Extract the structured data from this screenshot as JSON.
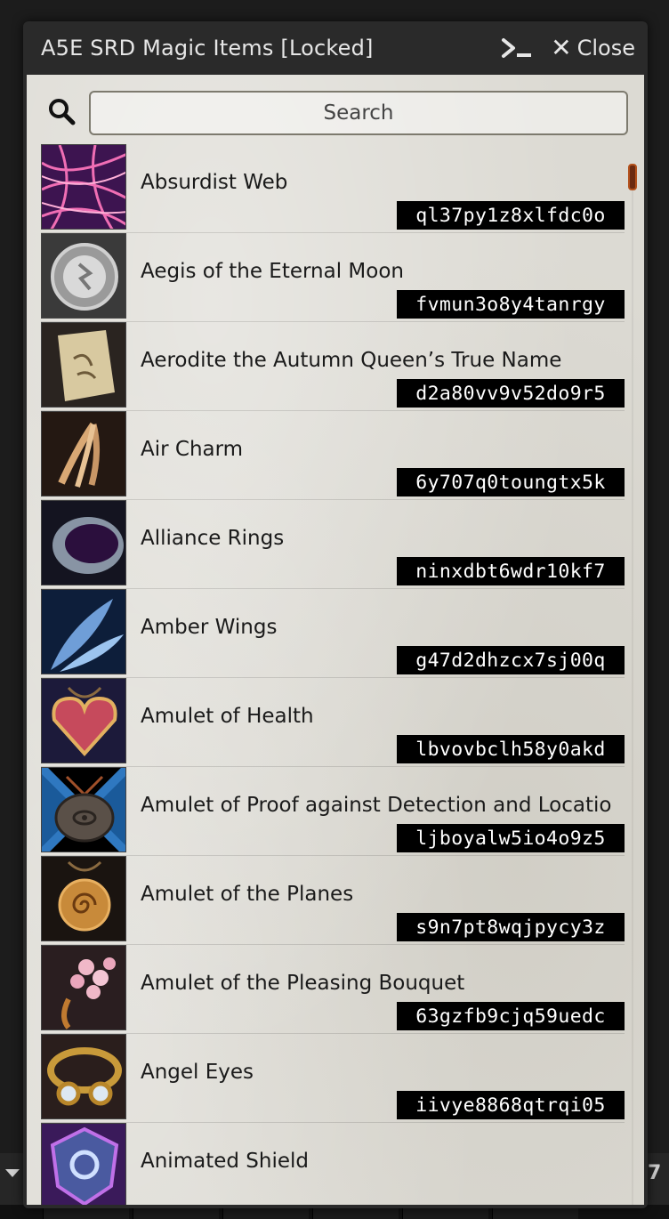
{
  "window": {
    "title": "A5E SRD Magic Items [Locked]",
    "close_label": "Close"
  },
  "search": {
    "placeholder": "Search",
    "value": ""
  },
  "items": [
    {
      "name": "Absurdist Web",
      "id": "ql37py1z8xlfdc0o",
      "icon": "pink-web-icon"
    },
    {
      "name": "Aegis of the Eternal Moon",
      "id": "fvmun3o8y4tanrgy",
      "icon": "silver-shield-icon"
    },
    {
      "name": "Aerodite the Autumn Queen’s True Name",
      "id": "d2a80vv9v52do9r5",
      "icon": "parchment-icon"
    },
    {
      "name": "Air Charm",
      "id": "6y707q0toungtx5k",
      "icon": "feather-charm-icon"
    },
    {
      "name": "Alliance Rings",
      "id": "ninxdbt6wdr10kf7",
      "icon": "ring-icon"
    },
    {
      "name": "Amber Wings",
      "id": "g47d2dhzcx7sj00q",
      "icon": "wings-icon"
    },
    {
      "name": "Amulet of Health",
      "id": "lbvovbclh58y0akd",
      "icon": "heart-amulet-icon"
    },
    {
      "name": "Amulet of Proof against Detection and Locatio",
      "id": "ljboyalw5io4o9z5",
      "icon": "eye-amulet-icon"
    },
    {
      "name": "Amulet of the Planes",
      "id": "s9n7pt8wqjpycy3z",
      "icon": "spiral-amulet-icon"
    },
    {
      "name": "Amulet of the Pleasing Bouquet",
      "id": "63gzfb9cjq59uedc",
      "icon": "bouquet-icon"
    },
    {
      "name": "Angel Eyes",
      "id": "iivye8868qtrqi05",
      "icon": "goggles-icon"
    },
    {
      "name": "Animated Shield",
      "id": "",
      "icon": "animated-shield-icon"
    }
  ],
  "underlay": {
    "number": "7"
  }
}
